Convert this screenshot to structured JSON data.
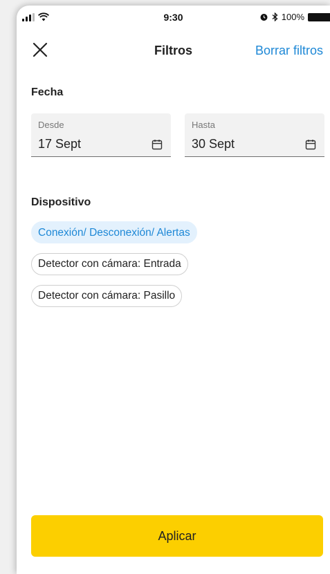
{
  "status_bar": {
    "time": "9:30",
    "battery_text": "100%",
    "icons": [
      "signal-icon",
      "wifi-icon",
      "alarm-icon",
      "bluetooth-icon",
      "battery-icon"
    ]
  },
  "header": {
    "title": "Filtros",
    "clear_label": "Borrar filtros",
    "close_icon": "close-icon"
  },
  "date_section": {
    "title": "Fecha",
    "from": {
      "label": "Desde",
      "value": "17 Sept"
    },
    "to": {
      "label": "Hasta",
      "value": "30 Sept"
    }
  },
  "device_section": {
    "title": "Dispositivo",
    "chips": [
      {
        "label": "Conexión/ Desconexión/ Alertas",
        "selected": true
      },
      {
        "label": "Detector con cámara: Entrada",
        "selected": false
      },
      {
        "label": "Detector con cámara: Pasillo",
        "selected": false
      }
    ]
  },
  "apply_label": "Aplicar",
  "colors": {
    "accent": "#1e88d6",
    "chip_selected_bg": "#e3f1fd",
    "apply_button": "#fccf00",
    "field_bg": "#f2f2f2"
  }
}
